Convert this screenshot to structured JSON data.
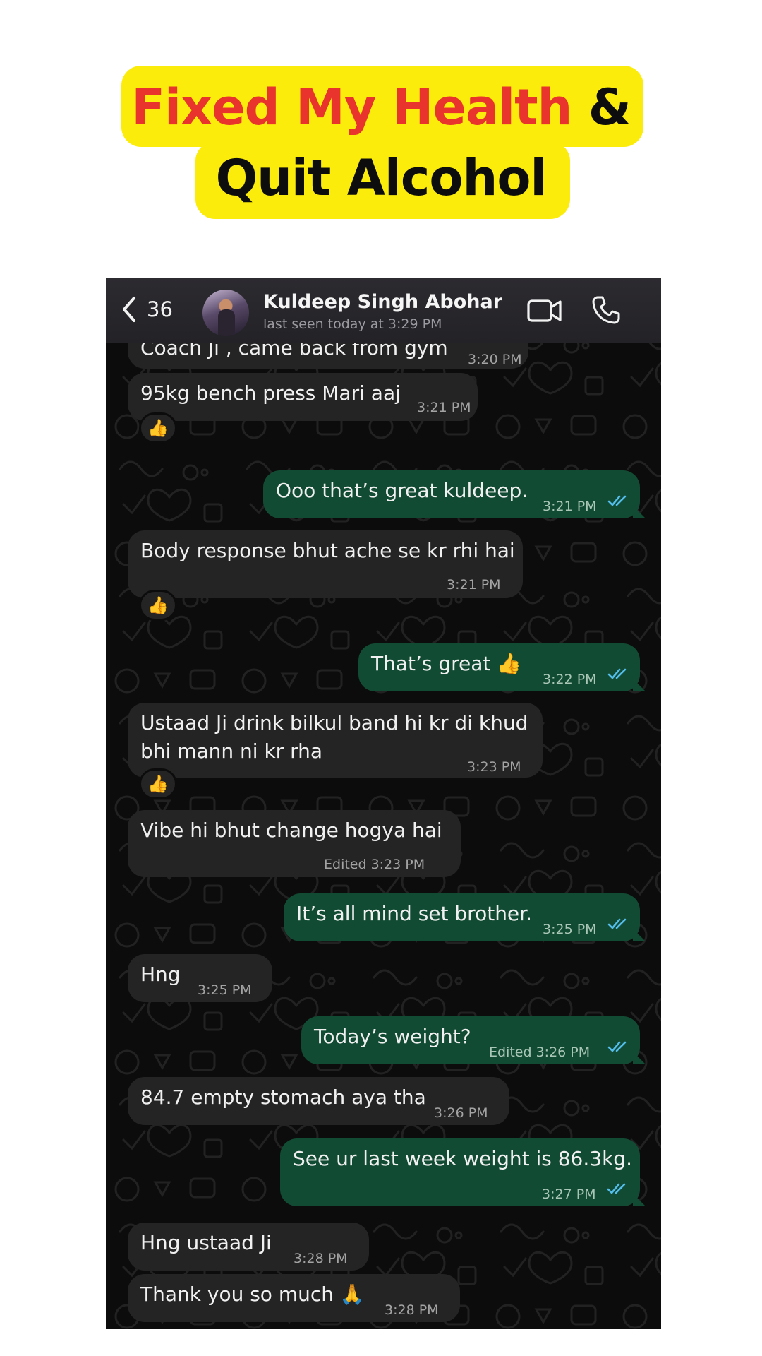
{
  "headline": {
    "line1_red": "Fixed My Health",
    "line1_black": " &",
    "line2": "Quit Alcohol"
  },
  "chat": {
    "back_count": "36",
    "contact_name": "Kuldeep Singh Abohar",
    "last_seen": "last seen today at 3:29 PM",
    "header_icons": [
      "chevron-left-icon",
      "video-call-icon",
      "phone-call-icon"
    ],
    "colors": {
      "incoming_bubble": "#242424",
      "outgoing_bubble": "#124b33",
      "read_ticks": "#53bdeb",
      "headline_highlight": "#fcec0c",
      "headline_red": "#e8342c"
    },
    "messages": [
      {
        "dir": "in",
        "text": "Coach Ji , came back from gym",
        "time": "3:20 PM"
      },
      {
        "dir": "in",
        "text": "95kg bench press Mari aaj",
        "time": "3:21 PM",
        "reaction": "👍"
      },
      {
        "dir": "out",
        "text": "Ooo that’s great kuldeep.",
        "time": "3:21 PM"
      },
      {
        "dir": "in",
        "text": "Body response bhut ache se kr rhi hai",
        "time": "3:21 PM",
        "reaction": "👍"
      },
      {
        "dir": "out",
        "text": "That’s great 👍",
        "time": "3:22 PM"
      },
      {
        "dir": "in",
        "text_line1": "Ustaad Ji drink bilkul band hi kr di khud",
        "text_line2": "bhi mann ni kr rha",
        "time": "3:23 PM",
        "reaction": "👍"
      },
      {
        "dir": "in",
        "text": "Vibe hi bhut change hogya hai",
        "time": "Edited 3:23 PM"
      },
      {
        "dir": "out",
        "text": "It’s all mind set brother.",
        "time": "3:25 PM"
      },
      {
        "dir": "in",
        "text": "Hng",
        "time": "3:25 PM"
      },
      {
        "dir": "out",
        "text": "Today’s weight?",
        "time": "Edited 3:26 PM"
      },
      {
        "dir": "in",
        "text": "84.7 empty stomach aya tha",
        "time": "3:26 PM"
      },
      {
        "dir": "out",
        "text": "See ur last week weight is 86.3kg.",
        "time": "3:27 PM"
      },
      {
        "dir": "in",
        "text": "Hng ustaad Ji",
        "time": "3:28 PM"
      },
      {
        "dir": "in",
        "text": "Thank you so much 🙏",
        "time": "3:28 PM"
      }
    ]
  }
}
